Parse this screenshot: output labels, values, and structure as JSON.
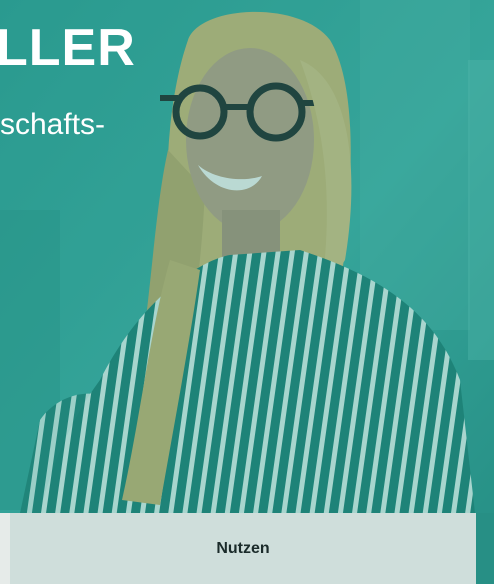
{
  "hero": {
    "title": "LLER",
    "subtitle": "schafts-"
  },
  "tabs": [
    {
      "label": "Nutzen"
    }
  ],
  "colors": {
    "teal_overlay": "#2c9b90",
    "tab_background": "#cfdedb",
    "text_light": "#ffffff",
    "text_dark": "#1b2b2a"
  }
}
